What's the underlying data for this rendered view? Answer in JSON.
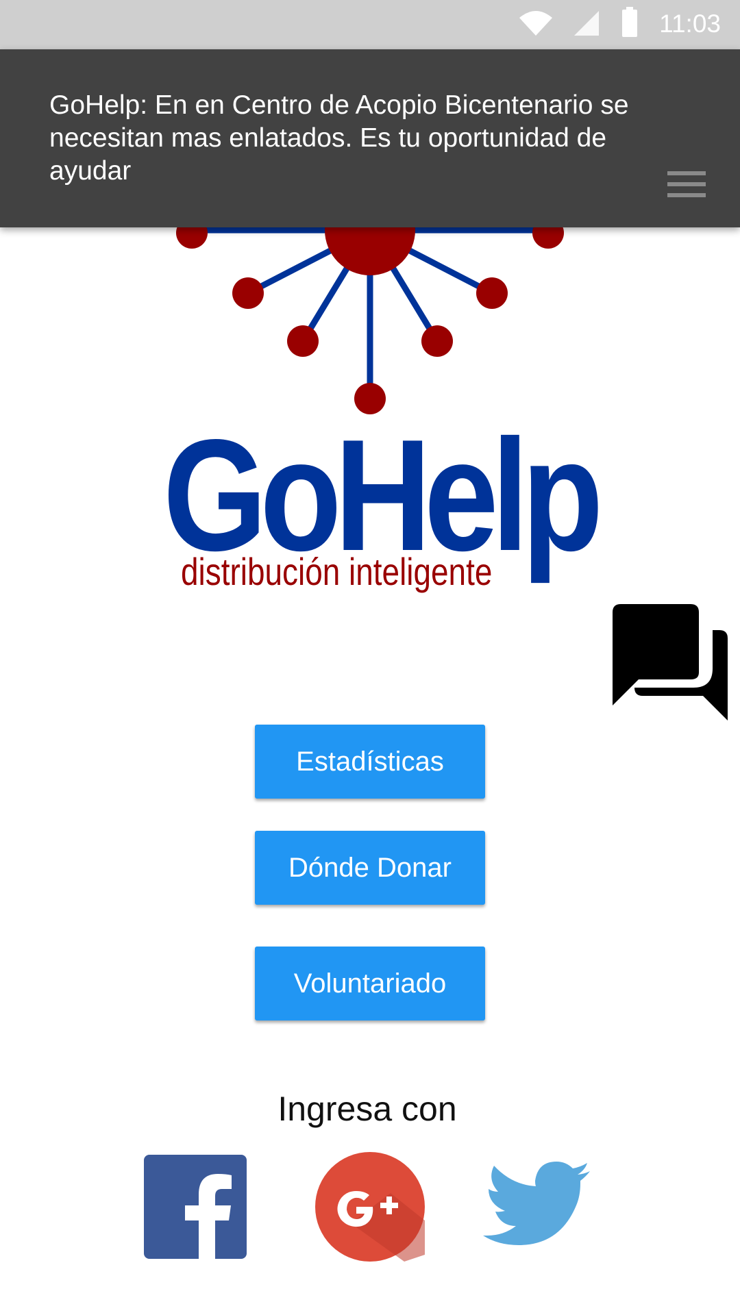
{
  "status_bar": {
    "time": "11:03",
    "icons": [
      "wifi-icon",
      "signal-icon",
      "battery-icon"
    ]
  },
  "notification": {
    "text": "GoHelp: En en Centro de Acopio Bicentenario se necesitan mas enlatados. Es tu oportunidad de ayudar",
    "icon": "menu-icon"
  },
  "logo": {
    "title": "GoHelp",
    "subtitle": "distribución inteligente",
    "colors": {
      "blue": "#003399",
      "red": "#990000"
    }
  },
  "chat_button": {
    "icon": "chat-icon"
  },
  "buttons": {
    "stats": "Estadísticas",
    "donate": "Dónde Donar",
    "volunteer": "Voluntariado"
  },
  "login": {
    "label": "Ingresa con",
    "providers": [
      "facebook-icon",
      "google-plus-icon",
      "twitter-icon"
    ]
  },
  "colors": {
    "status_bar_bg": "#cfcfcf",
    "notification_bg": "#424242",
    "button_bg": "#2196f3",
    "facebook": "#3b5998",
    "google_plus": "#dd4b39",
    "twitter": "#5aa9dd"
  }
}
